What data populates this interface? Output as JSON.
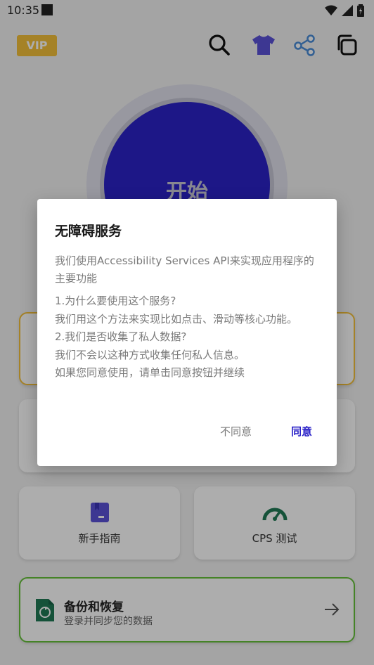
{
  "status_bar": {
    "time": "10:35",
    "icons": [
      "wifi-icon",
      "signal-icon",
      "battery-charging-icon"
    ]
  },
  "toolbar": {
    "vip_label": "VIP",
    "icons": [
      "search-icon",
      "tshirt-icon",
      "share-icon",
      "copy-icon"
    ]
  },
  "main": {
    "start_label": "开始"
  },
  "cards": {
    "guide_label": "新手指南",
    "cps_label": "CPS 测试",
    "backup": {
      "title": "备份和恢复",
      "subtitle": "登录并同步您的数据"
    }
  },
  "dialog": {
    "title": "无障碍服务",
    "intro": "我们使用Accessibility Services API来实现应用程序的主要功能",
    "lines": [
      "1.为什么要使用这个服务?",
      "我们用这个方法来实现比如点击、滑动等核心功能。",
      "2.我们是否收集了私人数据?",
      "我们不会以这种方式收集任何私人信息。",
      "如果您同意使用，请单击同意按钮并继续"
    ],
    "disagree_label": "不同意",
    "agree_label": "同意"
  },
  "colors": {
    "accent": "#2b23c8",
    "vip": "#f3c03a",
    "backup_border": "#66c23a",
    "icon_green": "#1f7a55"
  }
}
